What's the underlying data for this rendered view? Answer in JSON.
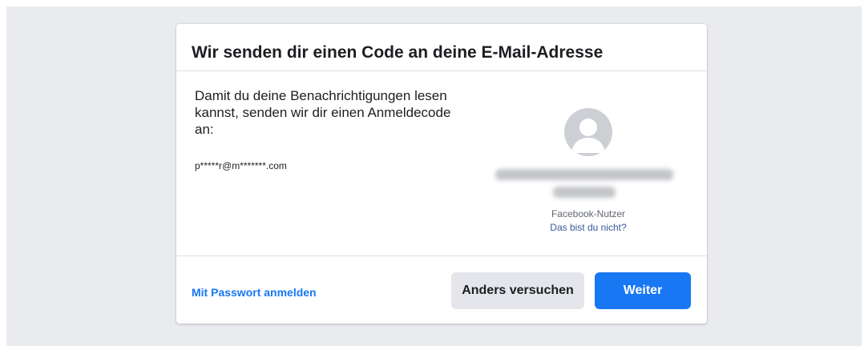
{
  "dialog": {
    "title": "Wir senden dir einen Code an deine E-Mail-Adresse",
    "description": "Damit du deine Benachrichtigungen lesen kannst, senden wir dir einen Anmeldecode an:",
    "email": "p*****r@m*******.com"
  },
  "profile": {
    "avatar_icon": "default-avatar-icon",
    "user_type": "Facebook-Nutzer",
    "not_you_link": "Das bist du nicht?"
  },
  "footer": {
    "password_login_link": "Mit Passwort anmelden",
    "try_other_button": "Anders versuchen",
    "continue_button": "Weiter"
  },
  "colors": {
    "backdrop": "#e9ebee",
    "primary": "#1877f2",
    "secondary_button": "#e4e6eb",
    "link": "#385898",
    "text": "#1c1e21",
    "muted_text": "#606770"
  }
}
